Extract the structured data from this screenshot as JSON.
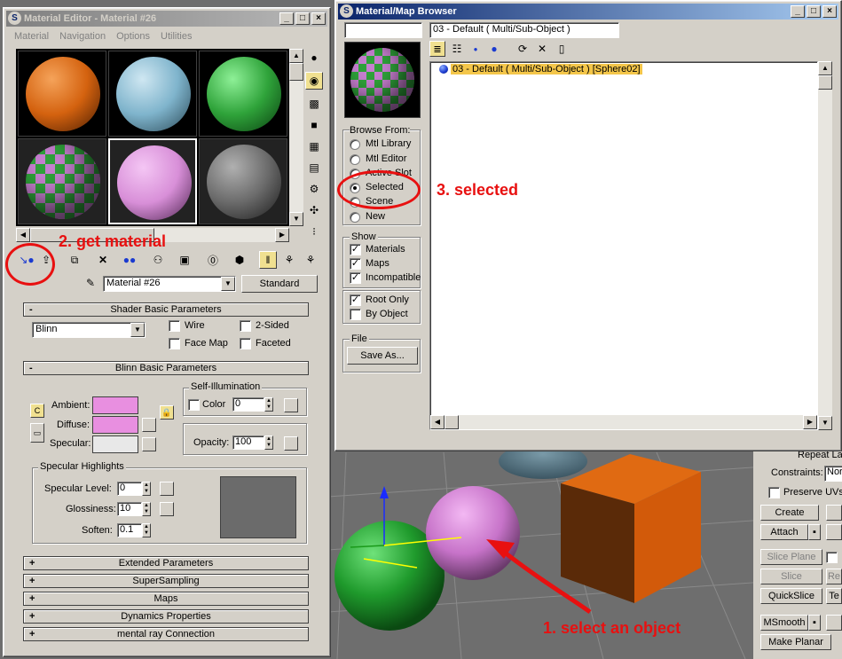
{
  "material_editor": {
    "title": "Material Editor - Material #26",
    "menu": [
      "Material",
      "Navigation",
      "Options",
      "Utilities"
    ],
    "material_name": "Material #26",
    "material_type": "Standard",
    "shader_rollout": "Shader Basic Parameters",
    "shader": "Blinn",
    "wire": "Wire",
    "two_sided": "2-Sided",
    "face_map": "Face Map",
    "faceted": "Faceted",
    "blinn_rollout": "Blinn Basic Parameters",
    "self_illum_group": "Self-Illumination",
    "self_illum_color": "Color",
    "self_illum_value": "0",
    "ambient": "Ambient:",
    "diffuse": "Diffuse:",
    "specular": "Specular:",
    "opacity_label": "Opacity:",
    "opacity_value": "100",
    "spec_highlights_group": "Specular Highlights",
    "spec_level_label": "Specular Level:",
    "spec_level_value": "0",
    "glossiness_label": "Glossiness:",
    "glossiness_value": "10",
    "soften_label": "Soften:",
    "soften_value": "0.1",
    "rollouts": [
      "Extended Parameters",
      "SuperSampling",
      "Maps",
      "Dynamics Properties",
      "mental ray Connection"
    ],
    "sphere_colors": [
      "#d4620f",
      "#7fb4cc",
      "#2fa33a",
      "checker",
      "#d88fd8",
      "#6b6b6b"
    ]
  },
  "browser": {
    "title": "Material/Map Browser",
    "name_field": "03 - Default  ( Multi/Sub-Object )",
    "list_item": "03 - Default  ( Multi/Sub-Object )  [Sphere02]",
    "browse_from_label": "Browse From:",
    "browse_from": [
      "Mtl Library",
      "Mtl Editor",
      "Active Slot",
      "Selected",
      "Scene",
      "New"
    ],
    "browse_selected": "Selected",
    "show_label": "Show",
    "show": [
      "Materials",
      "Maps",
      "Incompatible"
    ],
    "root_only": "Root Only",
    "by_object": "By Object",
    "file_label": "File",
    "save_as": "Save As..."
  },
  "right_panel": {
    "repeat": "Repeat La",
    "constraints": "Constraints:",
    "constraints_value": "Nor",
    "preserve_uvs": "Preserve UVs",
    "create": "Create",
    "attach": "Attach",
    "slice_plane": "Slice Plane",
    "slice": "Slice",
    "re": "Re",
    "quickslice": "QuickSlice",
    "te": "Te",
    "msmooth": "MSmooth",
    "make_planar": "Make Planar"
  },
  "annotations": {
    "step1": "1. select an object",
    "step2": "2. get material",
    "step3": "3. selected"
  },
  "colors": {
    "title_active": "#0a246a",
    "annotation": "#e81010",
    "viewport": "#6e6e6e",
    "ambient_swatch": "#e88fe0",
    "selection_highlight": "#f4c64a"
  }
}
